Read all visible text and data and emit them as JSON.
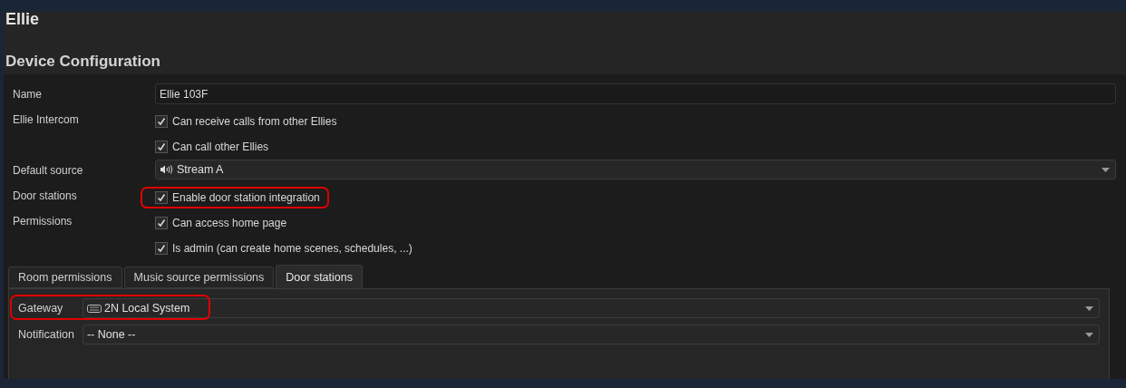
{
  "page_title": "Ellie",
  "section_title": "Device Configuration",
  "fields": [
    {
      "kind": "text",
      "label": "Name",
      "value": "Ellie 103F"
    },
    {
      "kind": "checks",
      "label": "Ellie Intercom",
      "options": [
        {
          "label": "Can receive calls from other Ellies",
          "checked": true,
          "highlighted": false
        },
        {
          "label": "Can call other Ellies",
          "checked": true,
          "highlighted": false
        }
      ]
    },
    {
      "kind": "audio_select",
      "label": "Default source",
      "value": "Stream A"
    },
    {
      "kind": "checks",
      "label": "Door stations",
      "options": [
        {
          "label": "Enable door station integration",
          "checked": true,
          "highlighted": true
        }
      ]
    },
    {
      "kind": "checks",
      "label": "Permissions",
      "options": [
        {
          "label": "Can access home page",
          "checked": true,
          "highlighted": false
        },
        {
          "label": "Is admin (can create home scenes, schedules, ...)",
          "checked": true,
          "highlighted": false
        }
      ]
    }
  ],
  "tabs": [
    {
      "label": "Room permissions",
      "selected": false
    },
    {
      "label": "Music source permissions",
      "selected": false
    },
    {
      "label": "Door stations",
      "selected": true
    }
  ],
  "tab_fields": [
    {
      "kind": "gateway",
      "label": "Gateway",
      "value": "2N Local System",
      "highlighted": true
    },
    {
      "kind": "plain",
      "label": "Notification",
      "value": "-- None --",
      "highlighted": false
    }
  ]
}
